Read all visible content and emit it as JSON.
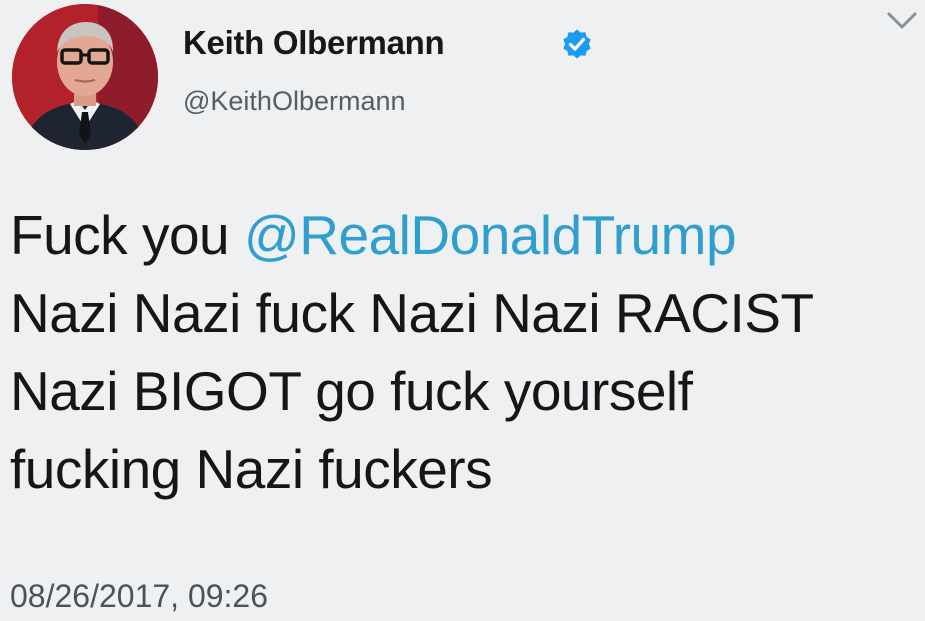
{
  "author": {
    "name": "Keith Olbermann",
    "handle": "@KeithOlbermann",
    "verified": true,
    "avatar_icon": "profile-photo",
    "verified_icon": "verified-badge-icon"
  },
  "menu": {
    "icon": "chevron-down-icon"
  },
  "tweet": {
    "line1_prefix": "Fuck you ",
    "mention": "@RealDonaldTrump",
    "line2": "Nazi Nazi fuck Nazi Nazi RACIST",
    "line3": "Nazi BIGOT go fuck yourself",
    "line4": "fucking Nazi fuckers"
  },
  "meta": {
    "timestamp": "08/26/2017, 09:26"
  },
  "colors": {
    "background": "#eef0f2",
    "text": "#141618",
    "mention": "#2f9fcf",
    "verified": "#1d9bf0",
    "handle": "#555d66"
  }
}
